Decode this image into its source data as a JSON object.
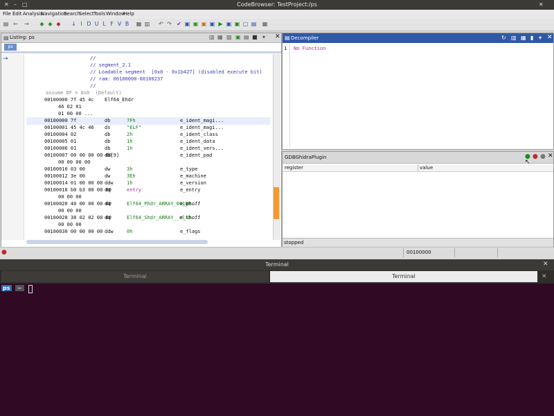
{
  "window": {
    "title": "CodeBrowser: TestProject:/ps",
    "controls": [
      "close-icon",
      "minimize-icon",
      "maximize-icon"
    ]
  },
  "menu": [
    "File",
    "Edit",
    "Analysis",
    "Navigation",
    "Search",
    "Select",
    "Tools",
    "Window",
    "Help"
  ],
  "listing": {
    "title": "Listing: ps",
    "tab": "ps",
    "lines": [
      {
        "addr": "",
        "bytes": "",
        "mn": "",
        "op": "",
        "cmt": "//",
        "sel": false
      },
      {
        "addr": "",
        "bytes": "",
        "mn": "",
        "op": "",
        "cmt": "// segment_2.1",
        "sel": false
      },
      {
        "addr": "",
        "bytes": "",
        "mn": "",
        "op": "",
        "cmt": "// Loadable segment  [0x0 - 0x1b427] (disabled execute bit)",
        "sel": false
      },
      {
        "addr": "",
        "bytes": "",
        "mn": "",
        "op": "",
        "cmt": "// ram: 00100000-00100237",
        "sel": false
      },
      {
        "addr": "",
        "bytes": "",
        "mn": "",
        "op": "",
        "cmt": "//",
        "sel": false
      },
      {
        "addr": "assume DF = 0x0  (Default)",
        "bytes": "",
        "mn": "",
        "op": "",
        "cmt": "",
        "sel": false
      },
      {
        "addr": "00100000 7f 45 4c",
        "bytes": "",
        "mn": "Elf64_Ehdr",
        "op": "",
        "cmt": "",
        "sel": false
      },
      {
        "addr": "",
        "bytes": "46 02 01",
        "mn": "",
        "op": "",
        "cmt": "",
        "sel": false
      },
      {
        "addr": "",
        "bytes": "01 00 00 ...",
        "mn": "",
        "op": "",
        "cmt": "",
        "sel": false
      },
      {
        "addr": "00100000 7f",
        "bytes": "",
        "mn": "db",
        "op": "7Fh",
        "cmt": "e_ident_magi...",
        "sel": true
      },
      {
        "addr": "00100001 45 4c 46",
        "bytes": "",
        "mn": "ds",
        "op": "\"ELF\"",
        "cmt": "e_ident_magi...",
        "sel": false
      },
      {
        "addr": "00100004 02",
        "bytes": "",
        "mn": "db",
        "op": "2h",
        "cmt": "e_ident_class",
        "sel": false
      },
      {
        "addr": "00100005 01",
        "bytes": "",
        "mn": "db",
        "op": "1h",
        "cmt": "e_ident_data",
        "sel": false
      },
      {
        "addr": "00100006 01",
        "bytes": "",
        "mn": "db",
        "op": "1h",
        "cmt": "e_ident_vers...",
        "sel": false
      },
      {
        "addr": "00100007 00 00 00 00 00",
        "bytes": "",
        "mn": "db[9]",
        "op": "",
        "cmt": "e_ident_pad",
        "sel": false
      },
      {
        "addr": "",
        "bytes": "00 00 00 00",
        "mn": "",
        "op": "",
        "cmt": "",
        "sel": false
      },
      {
        "addr": "00100010 03 00",
        "bytes": "",
        "mn": "dw",
        "op": "3h",
        "cmt": "e_type",
        "sel": false
      },
      {
        "addr": "00100012 3e 00",
        "bytes": "",
        "mn": "dw",
        "op": "3Eh",
        "cmt": "e_machine",
        "sel": false
      },
      {
        "addr": "00100014 01 00 00 00",
        "bytes": "",
        "mn": "ddw",
        "op": "1h",
        "cmt": "e_version",
        "sel": false
      },
      {
        "addr": "00100018 b0 b3 00 00 00",
        "bytes": "",
        "mn": "dq",
        "op": "entry",
        "cmt": "e_entry",
        "sel": false
      },
      {
        "addr": "",
        "bytes": "00 00 00",
        "mn": "",
        "op": "",
        "cmt": "",
        "sel": false
      },
      {
        "addr": "00100020 40 00 00 00 00",
        "bytes": "",
        "mn": "dq",
        "op": "Elf64_Phdr_ARRAY_00100...",
        "cmt": "e_phoff",
        "sel": false
      },
      {
        "addr": "",
        "bytes": "00 00 00",
        "mn": "",
        "op": "",
        "cmt": "",
        "sel": false
      },
      {
        "addr": "00100028 38 02 02 00 00",
        "bytes": "",
        "mn": "dq",
        "op": "Elf64_Shdr_ARRAY__elfS...",
        "cmt": "e_shoff",
        "sel": false
      },
      {
        "addr": "",
        "bytes": "00 00 00",
        "mn": "",
        "op": "",
        "cmt": "",
        "sel": false
      },
      {
        "addr": "00100030 00 00 00 00",
        "bytes": "",
        "mn": "ddw",
        "op": "0h",
        "cmt": "e_flags",
        "sel": false
      }
    ]
  },
  "decompiler": {
    "title": "Decompiler",
    "line_no": "1",
    "text": "No Function"
  },
  "gdb": {
    "title": "GDBGhidraPlugin",
    "col_register": "register",
    "col_value": "value",
    "status": "stopped"
  },
  "statusbar": {
    "address": "00100000"
  },
  "terminal": {
    "window_title": "Terminal",
    "tabs": [
      "Terminal",
      "Terminal"
    ],
    "prompt": "ps",
    "prompt_sep": "~"
  },
  "colors": {
    "accent": "#2f59a7",
    "terminal_bg": "#300a24",
    "listing_magenta": "#b0289b",
    "listing_green": "#1a7a1a",
    "scroll_thumb": "#f59a33"
  }
}
